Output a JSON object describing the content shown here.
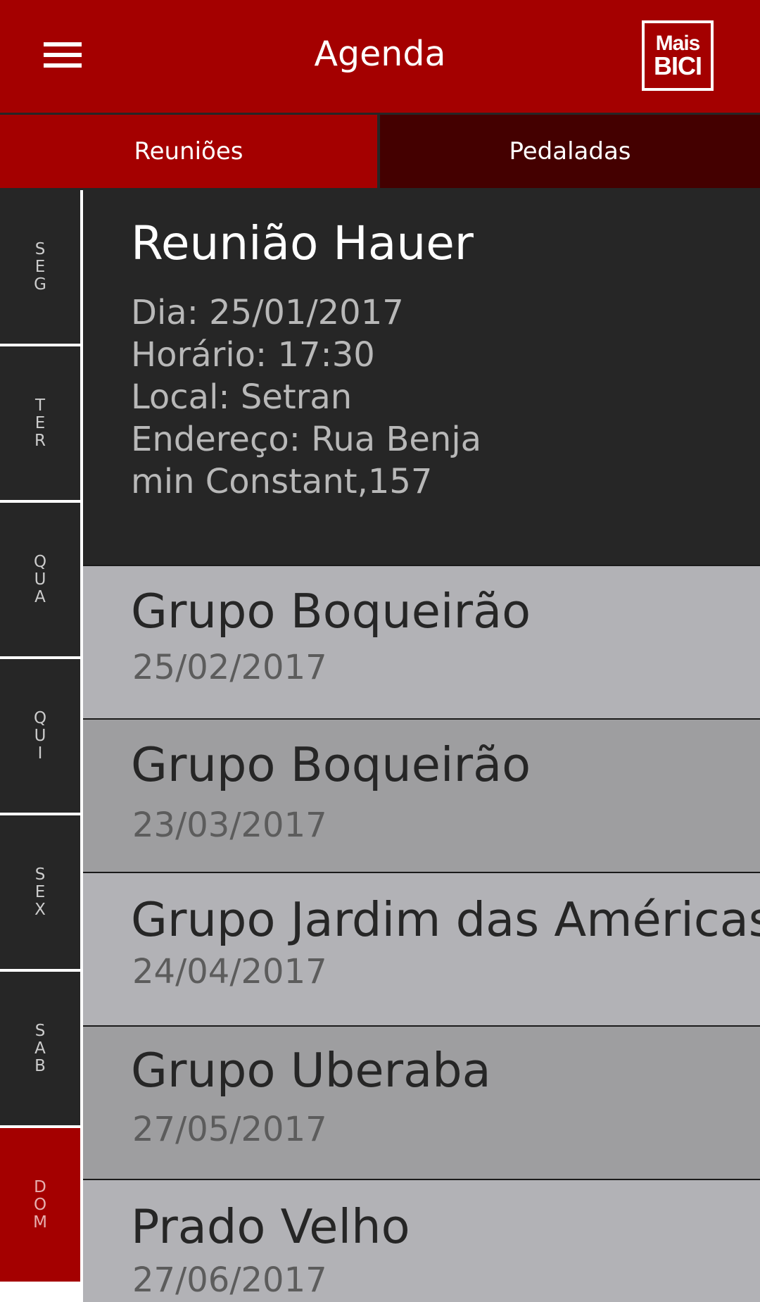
{
  "header": {
    "title": "Agenda",
    "logo_line1": "Mais",
    "logo_line2": "BICI",
    "menu_icon": "hamburger-menu-icon",
    "colors": {
      "primary": "#a40000",
      "tab_inactive": "#440000",
      "dark": "#262626"
    }
  },
  "tabs": [
    {
      "label": "Reuniões"
    },
    {
      "label": "Pedaladas"
    }
  ],
  "days": [
    {
      "label": "S\nE\nG"
    },
    {
      "label": "T\nE\nR"
    },
    {
      "label": "Q\nU\nA"
    },
    {
      "label": "Q\nU\nI"
    },
    {
      "label": "S\nE\nX"
    },
    {
      "label": "S\nA\nB"
    },
    {
      "label": "D\nO\nM"
    }
  ],
  "featured": {
    "title": "Reunião Hauer",
    "lines": [
      "Dia: 25/01/2017",
      "Horário: 17:30",
      "Local: Setran",
      "Endereço: Rua Benja",
      "min Constant,157"
    ]
  },
  "events": [
    {
      "title": "Grupo Boqueirão",
      "date": "25/02/2017"
    },
    {
      "title": "Grupo Boqueirão",
      "date": "23/03/2017"
    },
    {
      "title": "Grupo Jardim das Américas",
      "date": "24/04/2017"
    },
    {
      "title": "Grupo Uberaba",
      "date": "27/05/2017"
    },
    {
      "title": "Prado Velho",
      "date": "27/06/2017"
    }
  ]
}
